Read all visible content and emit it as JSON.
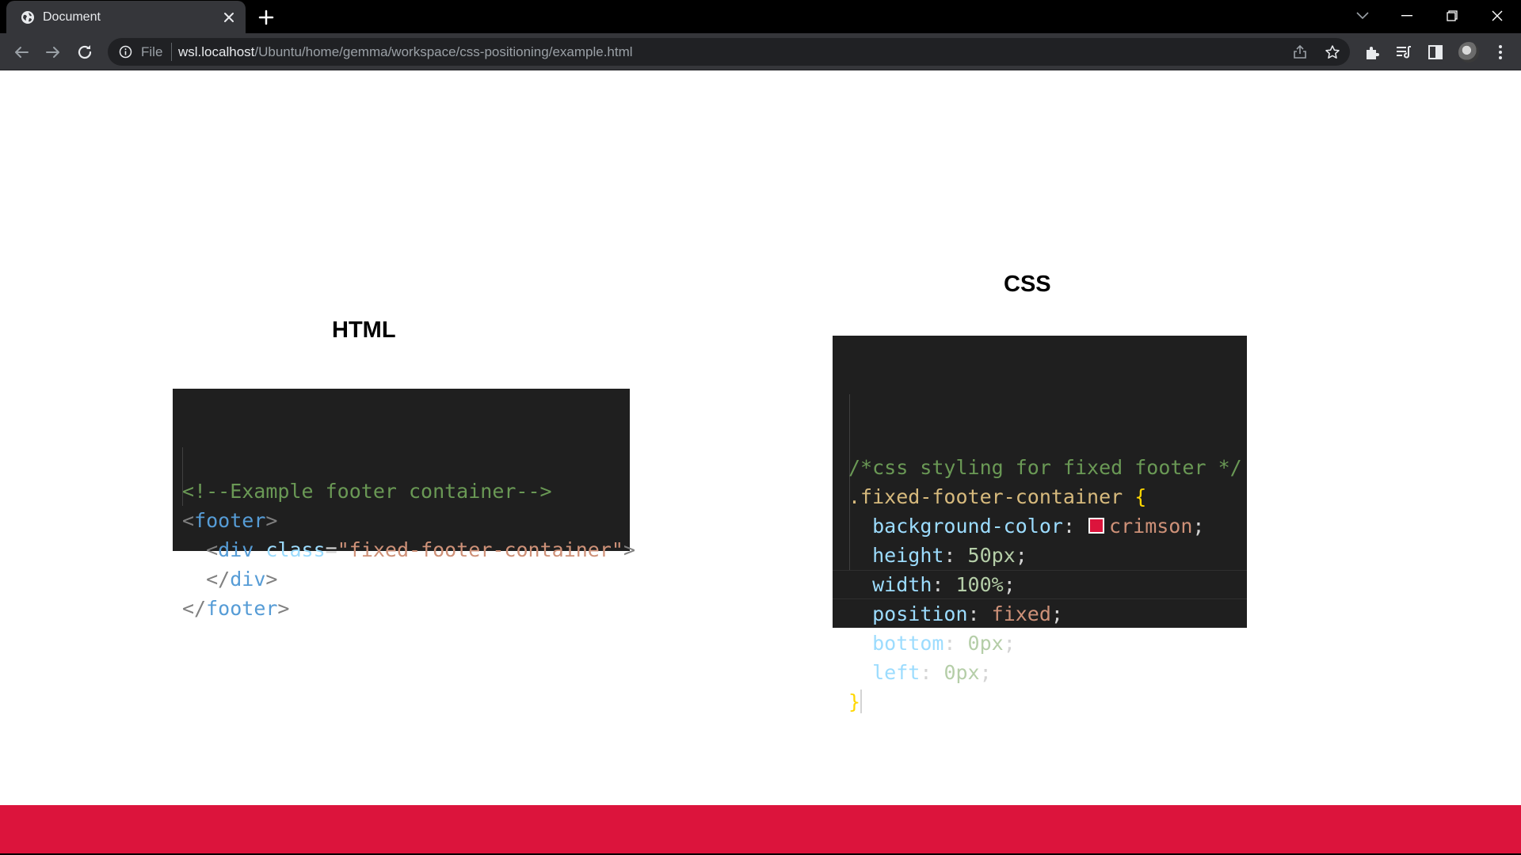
{
  "browser": {
    "tab": {
      "title": "Document"
    },
    "omnibox": {
      "scheme_label": "File",
      "url_host": "wsl.localhost",
      "url_path": "/Ubuntu/home/gemma/workspace/css-positioning/example.html"
    }
  },
  "page": {
    "html_heading": "HTML",
    "css_heading": "CSS",
    "html_code": [
      [
        {
          "t": "<!--Example footer container-->",
          "c": "comment"
        }
      ],
      [
        {
          "t": "<",
          "c": "punct"
        },
        {
          "t": "footer",
          "c": "tag"
        },
        {
          "t": ">",
          "c": "punct"
        }
      ],
      [
        {
          "t": "  ",
          "c": "plain"
        },
        {
          "t": "<",
          "c": "punct"
        },
        {
          "t": "div",
          "c": "tag"
        },
        {
          "t": " ",
          "c": "plain"
        },
        {
          "t": "class",
          "c": "attr"
        },
        {
          "t": "=",
          "c": "eq"
        },
        {
          "t": "\"fixed-footer-container\"",
          "c": "str"
        },
        {
          "t": ">",
          "c": "punct"
        }
      ],
      [
        {
          "t": "  ",
          "c": "plain"
        },
        {
          "t": "</",
          "c": "punct"
        },
        {
          "t": "div",
          "c": "tag"
        },
        {
          "t": ">",
          "c": "punct"
        }
      ],
      [
        {
          "t": "</",
          "c": "punct"
        },
        {
          "t": "footer",
          "c": "tag"
        },
        {
          "t": ">",
          "c": "punct"
        }
      ]
    ],
    "css_code": [
      [
        {
          "t": "/*css styling for fixed footer */",
          "c": "comment"
        }
      ],
      [
        {
          "t": ".fixed-footer-container",
          "c": "sel"
        },
        {
          "t": " ",
          "c": "plain"
        },
        {
          "t": "{",
          "c": "brace"
        }
      ],
      [
        {
          "t": "  ",
          "c": "plain"
        },
        {
          "t": "background-color",
          "c": "prop"
        },
        {
          "t": ": ",
          "c": "plain"
        },
        {
          "t": "",
          "c": "swatch"
        },
        {
          "t": "crimson",
          "c": "val"
        },
        {
          "t": ";",
          "c": "plain"
        }
      ],
      [
        {
          "t": "  ",
          "c": "plain"
        },
        {
          "t": "height",
          "c": "prop"
        },
        {
          "t": ": ",
          "c": "plain"
        },
        {
          "t": "50px",
          "c": "num"
        },
        {
          "t": ";",
          "c": "plain"
        }
      ],
      [
        {
          "t": "  ",
          "c": "plain"
        },
        {
          "t": "width",
          "c": "prop"
        },
        {
          "t": ": ",
          "c": "plain"
        },
        {
          "t": "100%",
          "c": "num"
        },
        {
          "t": ";",
          "c": "plain"
        }
      ],
      [
        {
          "t": "  ",
          "c": "plain"
        },
        {
          "t": "position",
          "c": "prop"
        },
        {
          "t": ": ",
          "c": "plain"
        },
        {
          "t": "fixed",
          "c": "val"
        },
        {
          "t": ";",
          "c": "plain"
        }
      ],
      [
        {
          "t": "  ",
          "c": "plain"
        },
        {
          "t": "bottom",
          "c": "prop"
        },
        {
          "t": ": ",
          "c": "plain"
        },
        {
          "t": "0px",
          "c": "num"
        },
        {
          "t": ";",
          "c": "plain"
        }
      ],
      [
        {
          "t": "  ",
          "c": "plain"
        },
        {
          "t": "left",
          "c": "prop"
        },
        {
          "t": ": ",
          "c": "plain"
        },
        {
          "t": "0px",
          "c": "num"
        },
        {
          "t": ";",
          "c": "plain"
        }
      ],
      [
        {
          "t": "}",
          "c": "brace"
        },
        {
          "t": "",
          "c": "cursor"
        }
      ]
    ]
  },
  "colors": {
    "footer_bar": "#dc143c",
    "code_background": "#1f1f1f",
    "tabstrip": "#000000",
    "toolbar": "#35363a"
  },
  "icons": {
    "tab": [
      "globe-icon",
      "close-icon",
      "plus-icon"
    ],
    "window": [
      "tab-search-chevron-icon",
      "minimize-icon",
      "restore-icon",
      "window-close-icon"
    ],
    "toolbar": [
      "back-arrow-icon",
      "forward-arrow-icon",
      "reload-icon",
      "info-icon",
      "share-icon",
      "star-icon",
      "puzzle-icon",
      "reading-list-icon",
      "side-panel-icon",
      "avatar",
      "kebab-menu-icon"
    ]
  }
}
